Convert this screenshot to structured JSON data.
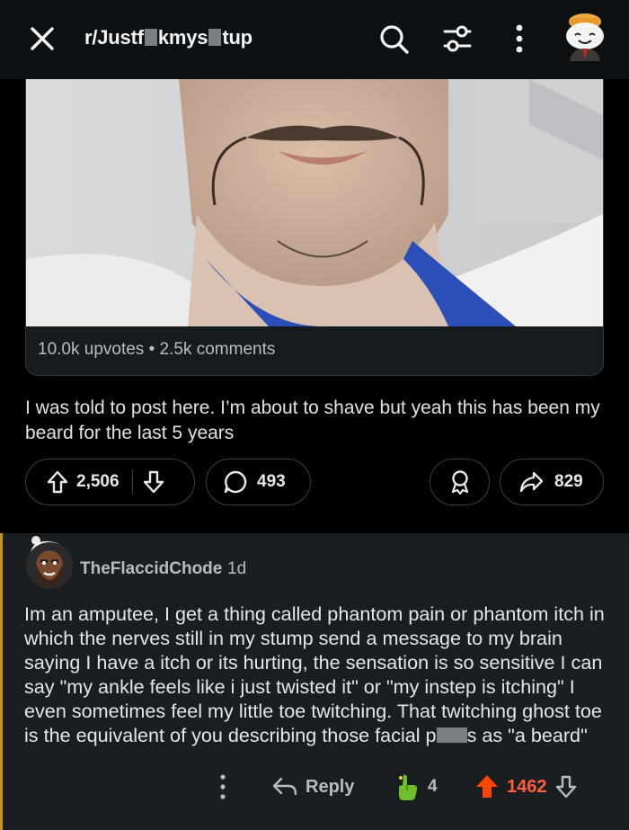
{
  "header": {
    "subreddit_parts": [
      "r/Justf",
      "kmys",
      "tup"
    ],
    "icons": [
      "close-icon",
      "search-icon",
      "filter-icon",
      "more-icon",
      "user-avatar"
    ]
  },
  "post": {
    "upvotes_text": "10.0k upvotes",
    "comments_text": "2.5k comments",
    "stats_sep": "•",
    "body": "I was told to post here. I’m about to shave but yeah this has been my beard for the last 5 years",
    "score": "2,506",
    "comment_count": "493",
    "share_count": "829"
  },
  "comment": {
    "author": "TheFlaccidChode",
    "time": "1d",
    "body_before": "Im an amputee, I get a thing called phantom pain or phantom itch in which the nerves still in my stump send a message to my brain saying I have a itch or its hurting, the sensation is so sensitive I can say \"my ankle feels like i just twisted it\" or \"my instep is itching\" I even sometimes feel my little toe twitching. That twitching ghost toe is the equivalent of you describing those facial p",
    "body_after": "s as \"a beard\"",
    "reply_label": "Reply",
    "award_count": "4",
    "score": "1462"
  },
  "colors": {
    "background": "#0e1113",
    "comment_bg": "#1b1e21",
    "thread_line": "#c4941b",
    "upvote_orange": "#ff4500",
    "award_green": "#7ec322"
  }
}
